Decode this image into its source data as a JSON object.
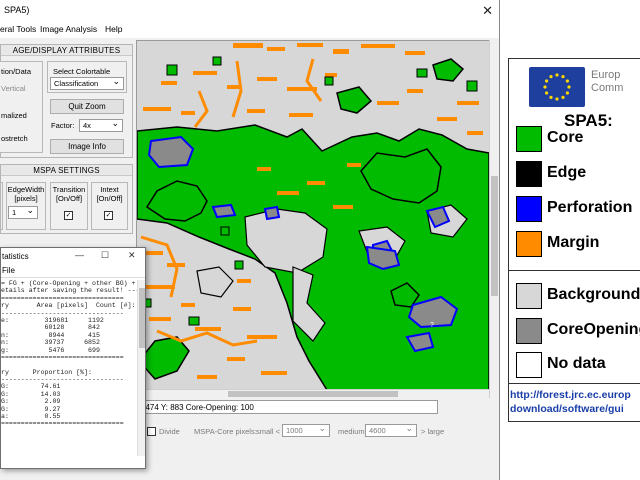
{
  "window": {
    "title": "SPA5)",
    "close": "✕"
  },
  "menu": [
    "eral Tools",
    "Image Analysis",
    "Help"
  ],
  "display_attributes": {
    "title": "AGE/DISPLAY ATTRIBUTES",
    "left_labels": [
      "tion/Data",
      "Vertical",
      "malized",
      "ostretch"
    ],
    "colortable_label": "Select Colortable",
    "colortable_value": "Classification",
    "quit_zoom": "Quit Zoom",
    "factor_label": "Factor:",
    "factor_value": "4x",
    "image_info": "Image Info"
  },
  "mspa_settings": {
    "title": "MSPA SETTINGS",
    "edge_width_label": "EdgeWidth\n[pixels]",
    "edge_width_value": "1",
    "transition_label": "Transition\n[On/Off]",
    "intext_label": "Intext\n[On/Off]",
    "check": "✓"
  },
  "status": {
    "coords": ": 474   Y: 883   Core-Opening: 100"
  },
  "options": {
    "divide": "Divide",
    "mspa_core_label": "MSPA-Core pixels:",
    "small": "small <",
    "small_value": "1000",
    "medium": "medium",
    "medium_value": "4600",
    "large": "> large"
  },
  "stats_dialog": {
    "title": "tatistics",
    "menu": "File",
    "minimize": "—",
    "maximize": "☐",
    "close": "✕",
    "lines": [
      "= FG + (Core-Opening + other BG) + Missing",
      "etails after saving the result! ---",
      "===============================",
      "ry       Area [pixels]  Count [#]:",
      "-------------------------------",
      "e:         319681     1192",
      "           60128      842",
      "n:          8944      415",
      "n:         39737     6852",
      "g:          5476      699",
      "===============================",
      "",
      "ry      Proportion [%]:",
      "-------------------------------",
      "G:        74.61",
      "G:        14.03",
      "G:         2.09",
      "G:         9.27",
      "a:         0.55",
      "==============================="
    ]
  },
  "legend": {
    "europe_lines": [
      "Europ",
      "Comm"
    ],
    "title": "SPA5:",
    "fg_items": [
      {
        "label": "Core",
        "color": "#00bb00"
      },
      {
        "label": "Edge",
        "color": "#000000"
      },
      {
        "label": "Perforation",
        "color": "#0000ff"
      },
      {
        "label": "Margin",
        "color": "#ff8c00"
      }
    ],
    "bg_items": [
      {
        "label": "Background",
        "color": "#d7d7d7"
      },
      {
        "label": "CoreOpening",
        "color": "#8a8a8a"
      },
      {
        "label": "No data",
        "color": "#ffffff"
      }
    ],
    "url_lines": [
      "http://forest.jrc.ec.europ",
      "download/software/gui"
    ]
  },
  "colors": {
    "core": "#00bb00",
    "edge": "#000000",
    "perforation": "#0000ff",
    "margin": "#ff8c00",
    "background": "#d7d7d7",
    "core_opening": "#8a8a8a"
  }
}
